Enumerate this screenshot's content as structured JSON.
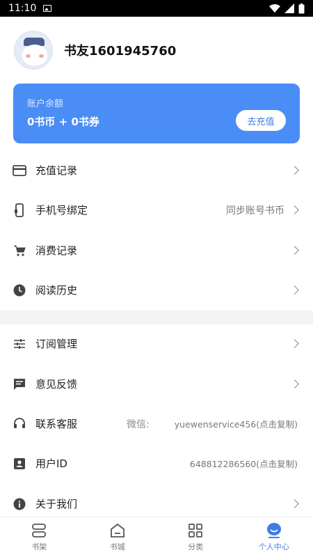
{
  "status_bar": {
    "time": "11:10"
  },
  "profile": {
    "username": "书友1601945760"
  },
  "balance": {
    "label": "账户余额",
    "amount": "0书币 + 0书券",
    "recharge_button": "去充值"
  },
  "menu": {
    "recharge_records": "充值记录",
    "phone_binding": "手机号绑定",
    "phone_binding_hint": "同步账号书币",
    "consumption_records": "消费记录",
    "reading_history": "阅读历史",
    "subscription": "订阅管理",
    "feedback": "意见反馈",
    "customer_service": "联系客服",
    "wechat_label": "微信:",
    "wechat_value": "yuewenservice456(点击复制)",
    "user_id": "用户ID",
    "user_id_value": "648812286560(点击复制)",
    "about": "关于我们"
  },
  "bottom_nav": [
    {
      "label": "书架",
      "icon": "bookshelf-icon"
    },
    {
      "label": "书城",
      "icon": "bookstore-icon"
    },
    {
      "label": "分类",
      "icon": "category-icon"
    },
    {
      "label": "个人中心",
      "icon": "profile-icon",
      "active": true
    }
  ],
  "colors": {
    "accent": "#4a8df7",
    "active_nav": "#3e7de8"
  }
}
